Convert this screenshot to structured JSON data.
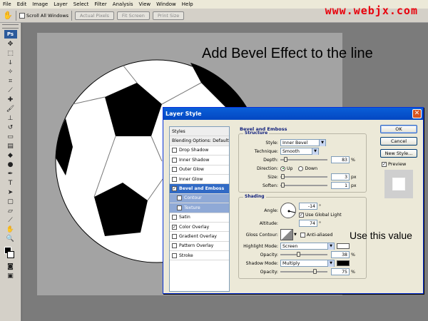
{
  "menu": [
    "File",
    "Edit",
    "Image",
    "Layer",
    "Select",
    "Filter",
    "Analysis",
    "View",
    "Window",
    "Help"
  ],
  "options_bar": {
    "scroll_all_label": "Scroll All Windows",
    "actual_pixels": "Actual Pixels",
    "fit_screen": "Fit Screen",
    "print_size": "Print Size"
  },
  "watermark": "www.webjx.com",
  "toolbar": {
    "logo": "Ps"
  },
  "heading": "Add Bevel Effect to the line",
  "note": "Use this value",
  "dialog": {
    "title": "Layer Style",
    "style_list": [
      {
        "label": "Styles",
        "kind": "head"
      },
      {
        "label": "Blending Options: Default",
        "kind": "head"
      },
      {
        "label": "Drop Shadow",
        "kind": "item",
        "checked": false
      },
      {
        "label": "Inner Shadow",
        "kind": "item",
        "checked": false
      },
      {
        "label": "Outer Glow",
        "kind": "item",
        "checked": false
      },
      {
        "label": "Inner Glow",
        "kind": "item",
        "checked": false
      },
      {
        "label": "Bevel and Emboss",
        "kind": "sel",
        "checked": true
      },
      {
        "label": "Contour",
        "kind": "sub",
        "checked": false
      },
      {
        "label": "Texture",
        "kind": "sub",
        "checked": false
      },
      {
        "label": "Satin",
        "kind": "item",
        "checked": false
      },
      {
        "label": "Color Overlay",
        "kind": "item",
        "checked": true
      },
      {
        "label": "Gradient Overlay",
        "kind": "item",
        "checked": false
      },
      {
        "label": "Pattern Overlay",
        "kind": "item",
        "checked": false
      },
      {
        "label": "Stroke",
        "kind": "item",
        "checked": false
      }
    ],
    "section_title": "Bevel and Emboss",
    "structure": {
      "title": "Structure",
      "style_label": "Style:",
      "style_value": "Inner Bevel",
      "technique_label": "Technique:",
      "technique_value": "Smooth",
      "depth_label": "Depth:",
      "depth_value": "83",
      "depth_unit": "%",
      "depth_fraction": 0.08,
      "direction_label": "Direction:",
      "dir_up": "Up",
      "dir_down": "Down",
      "size_label": "Size:",
      "size_value": "3",
      "size_unit": "px",
      "size_fraction": 0.02,
      "soften_label": "Soften:",
      "soften_value": "1",
      "soften_unit": "px",
      "soften_fraction": 0.01
    },
    "shading": {
      "title": "Shading",
      "angle_label": "Angle:",
      "angle_value": "-14",
      "angle_unit": "°",
      "global_light_label": "Use Global Light",
      "altitude_label": "Altitude:",
      "altitude_value": "74",
      "altitude_unit": "°",
      "gloss_label": "Gloss Contour:",
      "anti_aliased_label": "Anti-aliased",
      "highlight_label": "Highlight Mode:",
      "highlight_value": "Screen",
      "highlight_color": "#ffffff",
      "h_opacity_label": "Opacity:",
      "h_opacity_value": "38",
      "h_opacity_unit": "%",
      "h_opacity_fraction": 0.38,
      "shadow_label": "Shadow Mode:",
      "shadow_value": "Multiply",
      "shadow_color": "#000000",
      "s_opacity_label": "Opacity:",
      "s_opacity_value": "75",
      "s_opacity_unit": "%",
      "s_opacity_fraction": 0.75
    },
    "buttons": {
      "ok": "OK",
      "cancel": "Cancel",
      "new_style": "New Style...",
      "preview": "Preview"
    }
  },
  "colors": {
    "accent": "#0a5fd8",
    "watermark": "#e8000c"
  }
}
